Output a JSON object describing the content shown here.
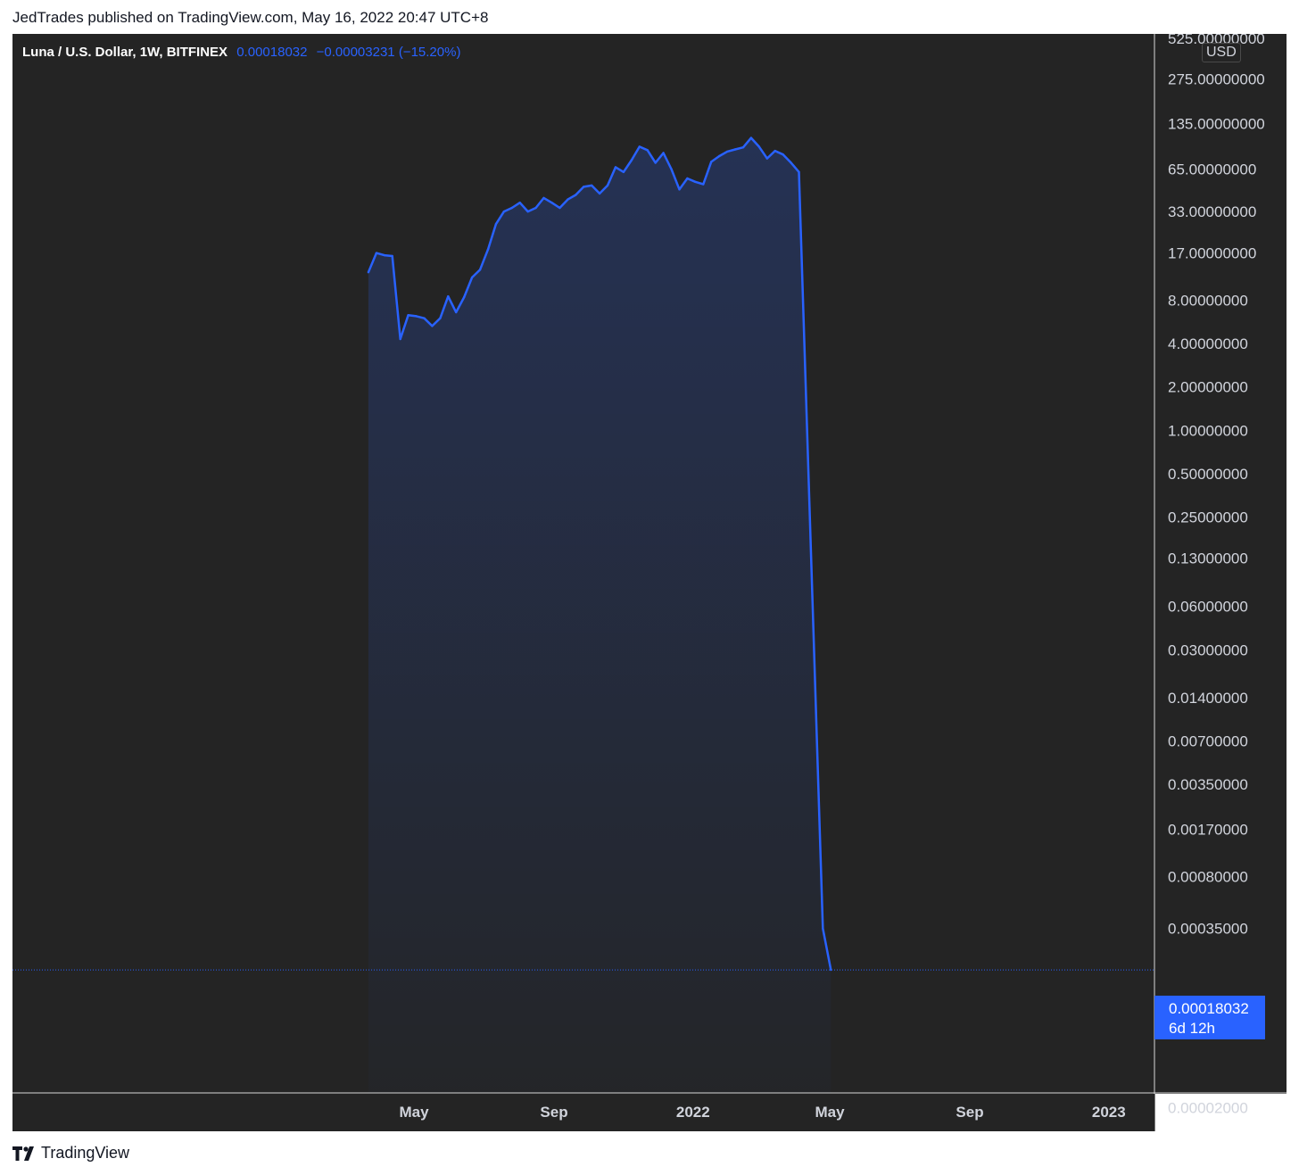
{
  "header": {
    "publisher_text": "JedTrades published on TradingView.com, May 16, 2022 20:47 UTC+8"
  },
  "legend": {
    "symbol": "Luna / U.S. Dollar, 1W, BITFINEX",
    "last": "0.00018032",
    "change": "−0.00003231 (−15.20%)"
  },
  "currency_badge": "USD",
  "last_price_label": {
    "price": "0.00018032",
    "countdown": "6d 12h"
  },
  "footer": {
    "brand": "TradingView"
  },
  "colors": {
    "background": "#242424",
    "line": "#2962ff",
    "axis_text": "#d1d4dc",
    "price_tag": "#2962ff"
  },
  "chart_data": {
    "type": "area",
    "title": "Luna / U.S. Dollar, 1W, BITFINEX",
    "xlabel": "",
    "ylabel": "",
    "y_scale": "log",
    "grid": false,
    "x_ticks": [
      {
        "label": "May",
        "x": "2021-05-01"
      },
      {
        "label": "Sep",
        "x": "2021-09-01"
      },
      {
        "label": "2022",
        "x": "2022-01-01"
      },
      {
        "label": "May",
        "x": "2022-05-01"
      },
      {
        "label": "Sep",
        "x": "2022-09-01"
      },
      {
        "label": "2023",
        "x": "2023-01-01"
      }
    ],
    "y_ticks": [
      {
        "label": "525.00000000",
        "value": 525
      },
      {
        "label": "275.00000000",
        "value": 275
      },
      {
        "label": "135.00000000",
        "value": 135
      },
      {
        "label": "65.00000000",
        "value": 65
      },
      {
        "label": "33.00000000",
        "value": 33
      },
      {
        "label": "17.00000000",
        "value": 17
      },
      {
        "label": "8.00000000",
        "value": 8
      },
      {
        "label": "4.00000000",
        "value": 4
      },
      {
        "label": "2.00000000",
        "value": 2
      },
      {
        "label": "1.00000000",
        "value": 1
      },
      {
        "label": "0.50000000",
        "value": 0.5
      },
      {
        "label": "0.25000000",
        "value": 0.25
      },
      {
        "label": "0.13000000",
        "value": 0.13
      },
      {
        "label": "0.06000000",
        "value": 0.06
      },
      {
        "label": "0.03000000",
        "value": 0.03
      },
      {
        "label": "0.01400000",
        "value": 0.014
      },
      {
        "label": "0.00700000",
        "value": 0.007
      },
      {
        "label": "0.00350000",
        "value": 0.0035
      },
      {
        "label": "0.00170000",
        "value": 0.0017
      },
      {
        "label": "0.00080000",
        "value": 0.0008
      },
      {
        "label": "0.00035000",
        "value": 0.00035
      },
      {
        "label": "0.00002000",
        "value": 2e-05
      }
    ],
    "series": [
      {
        "values": [
          [
            "2021-03-22",
            12.5
          ],
          [
            "2021-03-29",
            17.0
          ],
          [
            "2021-04-05",
            16.4
          ],
          [
            "2021-04-12",
            16.2
          ],
          [
            "2021-04-19",
            4.3
          ],
          [
            "2021-04-26",
            6.3
          ],
          [
            "2021-05-03",
            6.2
          ],
          [
            "2021-05-10",
            6.0
          ],
          [
            "2021-05-17",
            5.3
          ],
          [
            "2021-05-24",
            6.0
          ],
          [
            "2021-05-31",
            8.5
          ],
          [
            "2021-06-07",
            6.6
          ],
          [
            "2021-06-14",
            8.4
          ],
          [
            "2021-06-21",
            11.5
          ],
          [
            "2021-06-28",
            13.0
          ],
          [
            "2021-07-05",
            18.0
          ],
          [
            "2021-07-12",
            27.0
          ],
          [
            "2021-07-19",
            33.0
          ],
          [
            "2021-07-26",
            35.0
          ],
          [
            "2021-08-02",
            38.0
          ],
          [
            "2021-08-09",
            33.0
          ],
          [
            "2021-08-16",
            35.0
          ],
          [
            "2021-08-23",
            41.0
          ],
          [
            "2021-08-30",
            38.0
          ],
          [
            "2021-09-06",
            35.0
          ],
          [
            "2021-09-13",
            40.0
          ],
          [
            "2021-09-20",
            43.0
          ],
          [
            "2021-09-27",
            49.0
          ],
          [
            "2021-10-04",
            50.0
          ],
          [
            "2021-10-11",
            44.0
          ],
          [
            "2021-10-18",
            50.0
          ],
          [
            "2021-10-25",
            67.0
          ],
          [
            "2021-11-01",
            62.0
          ],
          [
            "2021-11-08",
            75.0
          ],
          [
            "2021-11-15",
            93.0
          ],
          [
            "2021-11-22",
            88.0
          ],
          [
            "2021-11-29",
            72.0
          ],
          [
            "2021-12-06",
            84.0
          ],
          [
            "2021-12-13",
            65.0
          ],
          [
            "2021-12-20",
            47.0
          ],
          [
            "2021-12-27",
            56.0
          ],
          [
            "2022-01-03",
            53.0
          ],
          [
            "2022-01-10",
            51.0
          ],
          [
            "2022-01-17",
            73.0
          ],
          [
            "2022-01-24",
            80.0
          ],
          [
            "2022-01-31",
            86.0
          ],
          [
            "2022-02-07",
            89.0
          ],
          [
            "2022-02-14",
            92.0
          ],
          [
            "2022-02-21",
            107.0
          ],
          [
            "2022-02-28",
            93.0
          ],
          [
            "2022-03-07",
            77.0
          ],
          [
            "2022-03-14",
            87.0
          ],
          [
            "2022-03-21",
            82.0
          ],
          [
            "2022-03-28",
            72.0
          ],
          [
            "2022-04-04",
            62.0
          ],
          [
            "2022-04-25",
            0.00035
          ],
          [
            "2022-05-02",
            0.00018032
          ]
        ]
      }
    ],
    "last_value": 0.00018032
  }
}
